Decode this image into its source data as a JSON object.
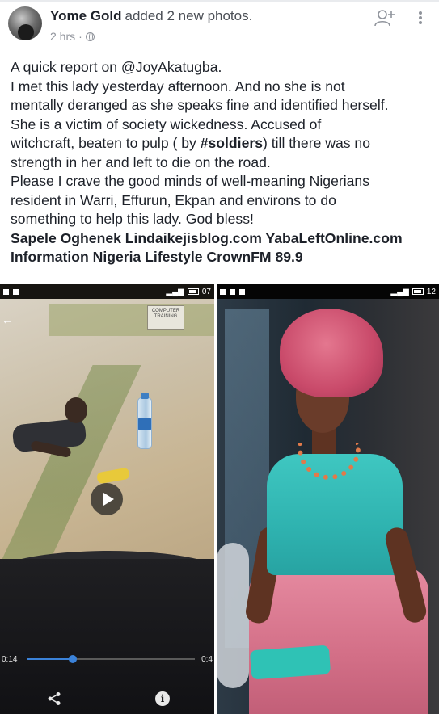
{
  "post": {
    "author": "Yome Gold",
    "action": "added 2 new photos.",
    "time": "2 hrs",
    "separator": "·",
    "text_lines": [
      "A quick report on @JoyAkatugba.",
      "I met this lady yesterday afternoon. And no she is not",
      "mentally deranged as she speaks fine and identified herself.",
      "She is a victim of society wickedness. Accused of",
      "witchcraft, beaten to pulp ( by ",
      "soldiers",
      ") till there was no",
      "strength in her and left to die on the road.",
      "Please I crave the good minds of well-meaning Nigerians",
      "resident in Warri, Effurun, Ekpan and environs to do",
      "something to help this lady. God bless!"
    ],
    "hashtag_prefix": "#",
    "tags_line_1": "Sapele Oghenek Lindaikejisblog.com YabaLeftOnline.com",
    "tags_line_2": "Information Nigeria Lifestyle CrownFM 89.9"
  },
  "photo_left": {
    "status_time": "07",
    "sign_text": "COMPUTER TRAINING",
    "video_elapsed": "0:14",
    "video_total": "0:4",
    "video_progress": 0.27,
    "info_glyph": "i"
  },
  "photo_right": {
    "status_time": "12"
  },
  "icons": {
    "avatar": "avatar",
    "privacy": "globe-icon",
    "add_friend": "add-friend-icon",
    "more": "more-options-icon",
    "play": "play-icon",
    "share": "share-icon",
    "info": "info-icon",
    "back": "back-arrow-icon"
  },
  "colors": {
    "text": "#1d2129",
    "meta": "#90949c",
    "progress": "#3b82d9"
  }
}
